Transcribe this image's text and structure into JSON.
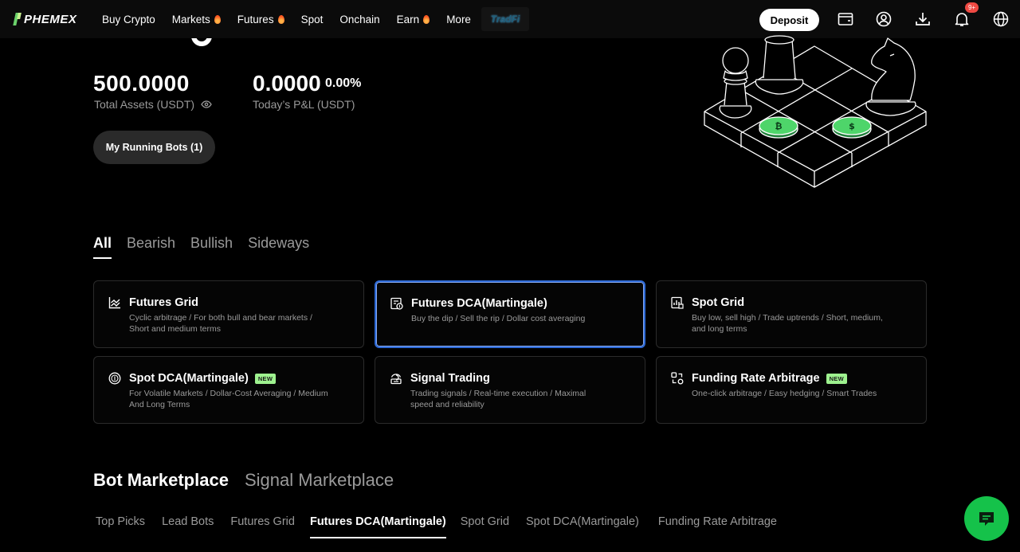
{
  "nav": {
    "logo_text": "PHEMEX",
    "items": [
      {
        "label": "Buy Crypto",
        "hot": false
      },
      {
        "label": "Markets",
        "hot": true
      },
      {
        "label": "Futures",
        "hot": true
      },
      {
        "label": "Spot",
        "hot": false
      },
      {
        "label": "Onchain",
        "hot": false
      },
      {
        "label": "Earn",
        "hot": true
      },
      {
        "label": "More",
        "hot": false
      }
    ],
    "promo_label": "TradFi",
    "deposit_label": "Deposit",
    "notification_count": "9+"
  },
  "summary": {
    "total_assets_value": "500.0000",
    "total_assets_label": "Total Assets (USDT)",
    "pnl_value": "0.0000",
    "pnl_percent": "0.00%",
    "pnl_label": "Today’s P&L (USDT)",
    "running_bots_label": "My Running Bots (1)"
  },
  "category_tabs": [
    "All",
    "Bearish",
    "Bullish",
    "Sideways"
  ],
  "cards": [
    {
      "title": "Futures Grid",
      "desc": "Cyclic arbitrage / For both bull and bear markets / Short and medium terms",
      "new": false,
      "icon": "chart-trend-icon"
    },
    {
      "title": "Futures DCA(Martingale)",
      "desc": "Buy the dip / Sell the rip / Dollar cost averaging",
      "new": false,
      "icon": "dca-icon"
    },
    {
      "title": "Spot Grid",
      "desc": "Buy low, sell high / Trade uptrends / Short, medium, and long terms",
      "new": false,
      "icon": "grid-chart-icon"
    },
    {
      "title": "Spot DCA(Martingale)",
      "desc": "For Volatile Markets / Dollar-Cost Averaging / Medium And Long Terms",
      "new": true,
      "icon": "coin-icon"
    },
    {
      "title": "Signal Trading",
      "desc": "Trading signals / Real-time execution / Maximal speed and reliability",
      "new": false,
      "icon": "signal-icon"
    },
    {
      "title": "Funding Rate Arbitrage",
      "desc": "One-click arbitrage / Easy hedging / Smart Trades",
      "new": true,
      "icon": "arbitrage-icon"
    }
  ],
  "new_badge_label": "NEW",
  "marketplace": {
    "title": "Bot Marketplace",
    "alt_title": "Signal Marketplace",
    "subtabs": [
      "Top Picks",
      "Lead Bots",
      "Futures Grid",
      "Futures DCA(Martingale)",
      "Spot Grid",
      "Spot DCA(Martingale)",
      "Funding Rate Arbitrage"
    ]
  },
  "colors": {
    "accent_green": "#15c24a",
    "selected_border": "#2e6ad8",
    "badge_red": "#ef4a43",
    "new_badge": "#9ef28f"
  }
}
